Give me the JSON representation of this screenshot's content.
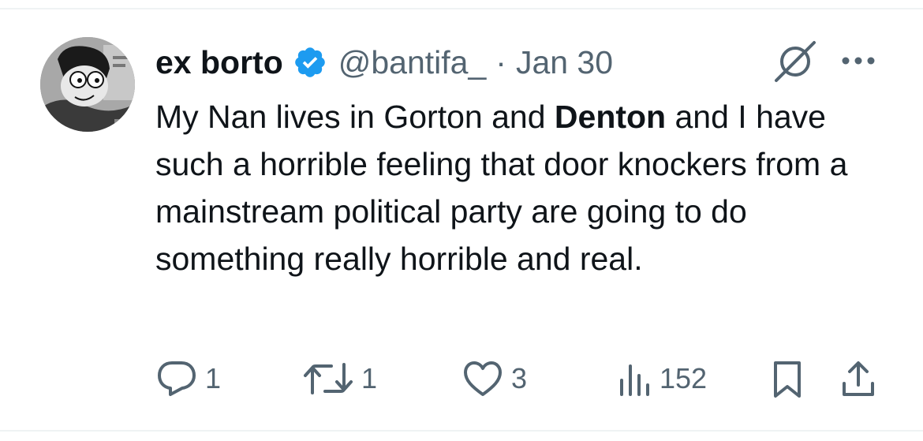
{
  "author": {
    "display_name": "ex borto",
    "handle": "@bantifa_",
    "separator": "·",
    "date": "Jan 30",
    "verified_color": "#1d9bf0"
  },
  "tweet": {
    "text_before": "My Nan lives in Gorton and ",
    "text_bold": "Denton",
    "text_after": " and I have such a horrible feeling that door knockers from a mainstream political party are going to do something really horrible and real."
  },
  "metrics": {
    "replies": "1",
    "reposts": "1",
    "likes": "3",
    "views": "152"
  },
  "icons": {
    "reply": "reply-icon",
    "repost": "repost-icon",
    "like": "heart-icon",
    "views": "views-icon",
    "bookmark": "bookmark-icon",
    "share": "share-icon",
    "grok": "grok-icon",
    "more": "more-icon",
    "verified": "verified-badge-icon"
  },
  "colors": {
    "text": "#0f1419",
    "secondary": "#536471",
    "accent": "#1d9bf0"
  }
}
